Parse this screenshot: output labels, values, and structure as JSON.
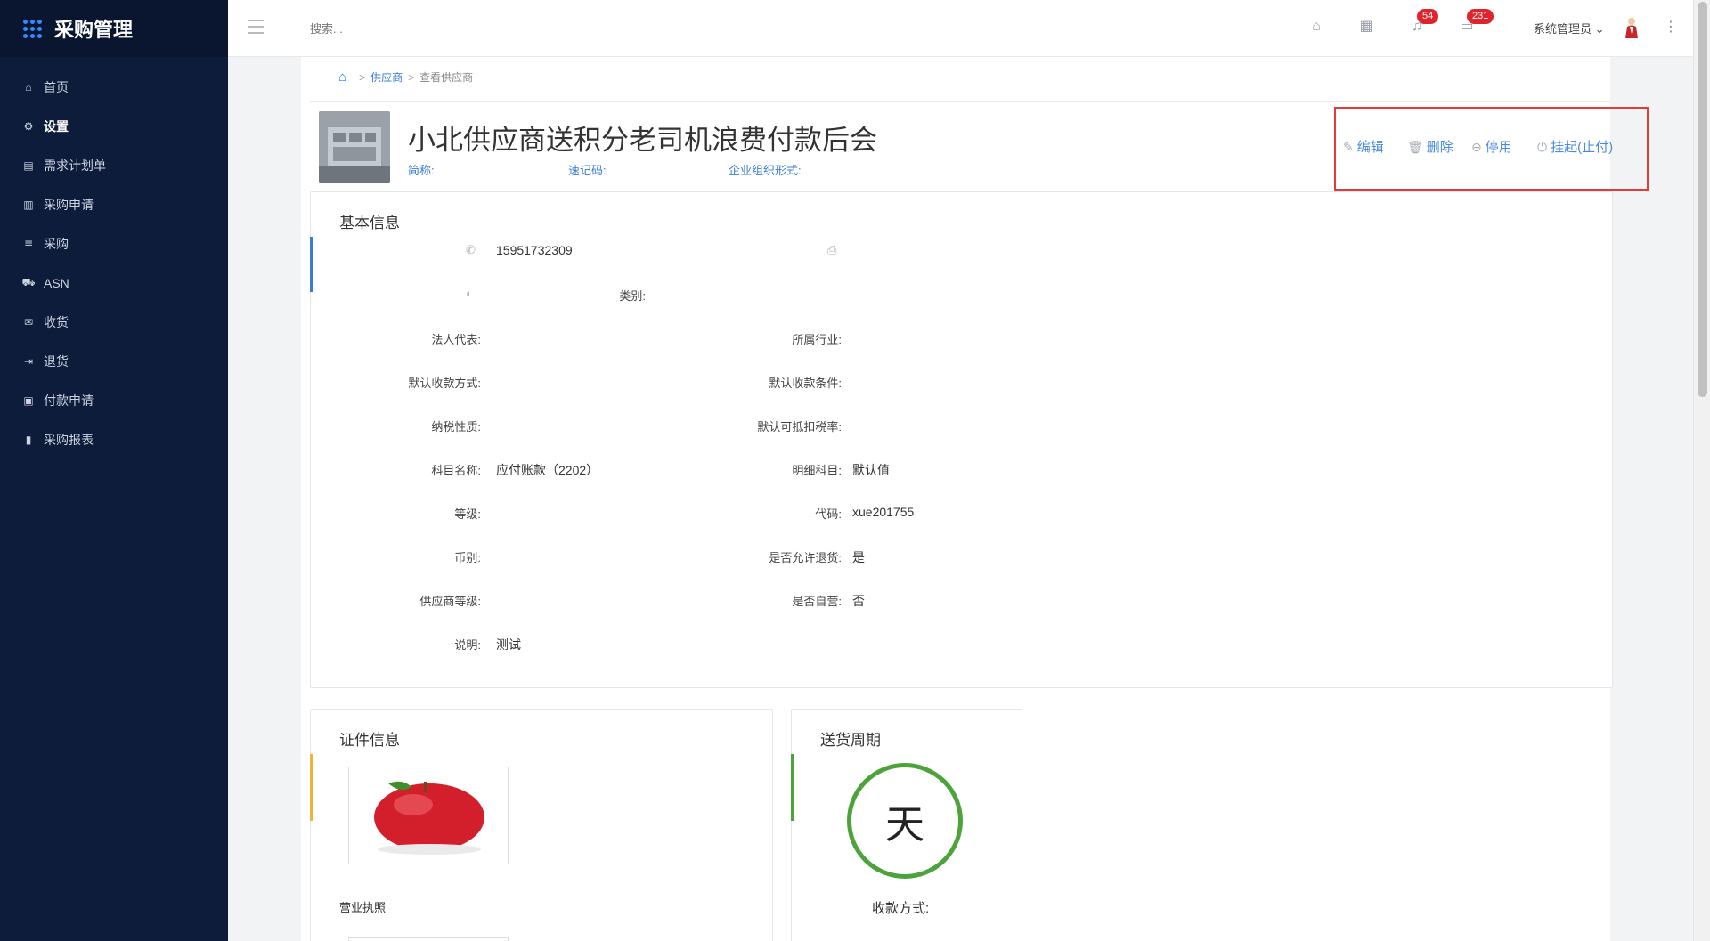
{
  "app": {
    "title": "采购管理"
  },
  "sidebar": {
    "items": [
      {
        "label": "首页",
        "icon": "home-icon"
      },
      {
        "label": "设置",
        "icon": "gear-icon"
      },
      {
        "label": "需求计划单",
        "icon": "document-icon"
      },
      {
        "label": "采购申请",
        "icon": "clipboard-icon"
      },
      {
        "label": "采购",
        "icon": "list-icon"
      },
      {
        "label": "ASN",
        "icon": "truck-icon"
      },
      {
        "label": "收货",
        "icon": "inbox-icon"
      },
      {
        "label": "退货",
        "icon": "return-icon"
      },
      {
        "label": "付款申请",
        "icon": "payment-icon"
      },
      {
        "label": "采购报表",
        "icon": "bar-chart-icon"
      }
    ]
  },
  "topbar": {
    "search_placeholder": "搜索...",
    "notifications_count": "54",
    "messages_count": "231",
    "user_name": "系统管理员"
  },
  "breadcrumb": {
    "level1": "供应商",
    "level2": "查看供应商"
  },
  "vendor": {
    "name": "小北供应商送积分老司机浪费付款后会",
    "short_name_label": "简称:",
    "quick_code_label": "速记码:",
    "org_form_label": "企业组织形式:"
  },
  "actions": {
    "edit": "编辑",
    "delete": "删除",
    "disable": "停用",
    "suspend": "挂起(止付)"
  },
  "basic_info": {
    "title": "基本信息",
    "phone": "15951732309",
    "left": [
      {
        "label": "法人代表:",
        "value": ""
      },
      {
        "label": "默认收款方式:",
        "value": ""
      },
      {
        "label": "纳税性质:",
        "value": ""
      },
      {
        "label": "科目名称:",
        "value": "应付账款（2202）"
      },
      {
        "label": "等级:",
        "value": ""
      },
      {
        "label": "币别:",
        "value": ""
      },
      {
        "label": "供应商等级:",
        "value": ""
      },
      {
        "label": "说明:",
        "value": "测试"
      }
    ],
    "right": [
      {
        "label": "类别:",
        "value": ""
      },
      {
        "label": "所属行业:",
        "value": ""
      },
      {
        "label": "默认收款条件:",
        "value": ""
      },
      {
        "label": "默认可抵扣税率:",
        "value": ""
      },
      {
        "label": "明细科目:",
        "value": "默认值"
      },
      {
        "label": "代码:",
        "value": "xue201755"
      },
      {
        "label": "是否允许退货:",
        "value": "是"
      },
      {
        "label": "是否自营:",
        "value": "否"
      }
    ]
  },
  "certificate": {
    "title": "证件信息",
    "caption": "营业执照"
  },
  "delivery": {
    "title": "送货周期",
    "unit": "天",
    "payment_label": "收款方式:"
  },
  "colors": {
    "accent_blue": "#3a7bd5",
    "sidebar_bg": "#0d1c3a",
    "highlight_red": "#e33b3b",
    "cycle_green": "#4ba33a",
    "cert_accent": "#f0b33a"
  }
}
